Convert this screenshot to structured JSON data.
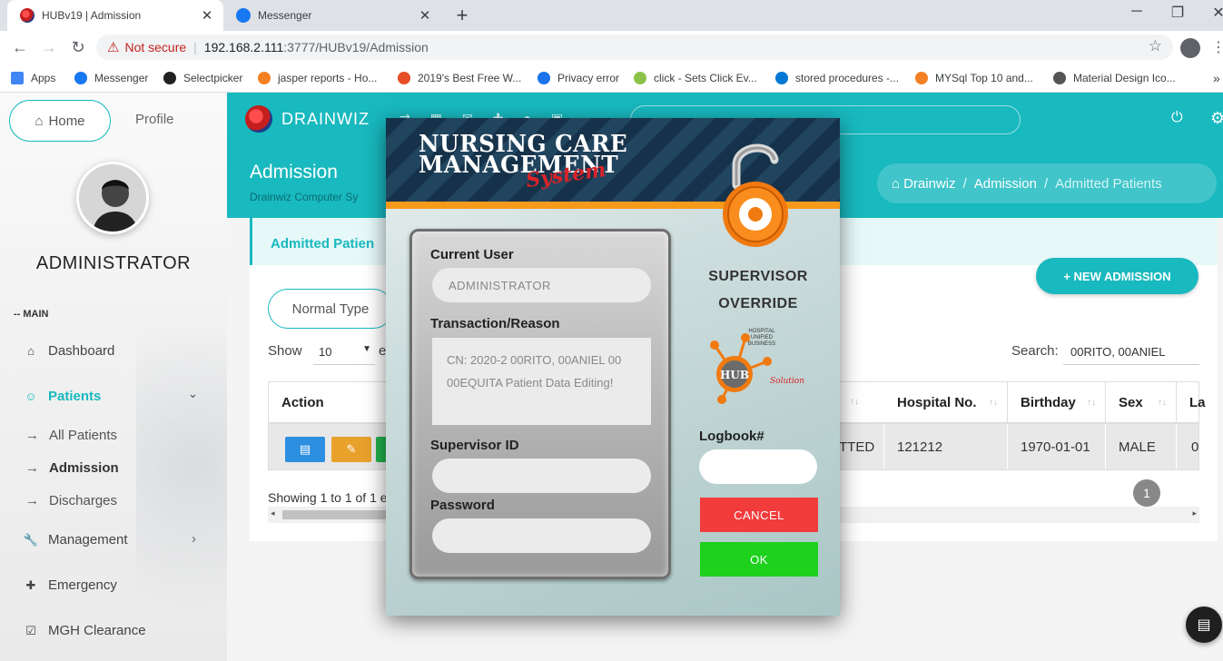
{
  "browser": {
    "tabs": [
      {
        "title": "HUBv19 | Admission",
        "close": "✕"
      },
      {
        "title": "Messenger",
        "close": "✕"
      }
    ],
    "new_tab": "+",
    "window_controls": {
      "minimize": "─",
      "maximize": "❐",
      "close": "✕"
    },
    "nav": {
      "back": "←",
      "forward": "→",
      "reload": "↻"
    },
    "address": {
      "warning_icon": "⚠",
      "not_secure": "Not secure",
      "separator": "|",
      "host": "192.168.2.111",
      "path": ":3777/HUBv19/Admission",
      "star": "☆"
    },
    "bookmarks": [
      {
        "label": "Apps",
        "color": "#4285f4"
      },
      {
        "label": "Messenger",
        "color": "#1877f2"
      },
      {
        "label": "Selectpicker",
        "color": "#222222"
      },
      {
        "label": "jasper reports - Ho...",
        "color": "#f48024"
      },
      {
        "label": "2019's Best Free W...",
        "color": "#e44d26"
      },
      {
        "label": "Privacy error",
        "color": "#1a73e8"
      },
      {
        "label": "click - Sets Click Ev...",
        "color": "#8bc34a"
      },
      {
        "label": "stored procedures -...",
        "color": "#0078d4"
      },
      {
        "label": "MYSql Top 10 and...",
        "color": "#f48024"
      },
      {
        "label": "Material Design Ico...",
        "color": "#555555"
      }
    ],
    "bookmarks_more": "»"
  },
  "sidebar": {
    "home": "Home",
    "profile": "Profile",
    "user_name": "ADMINISTRATOR",
    "section": "-- MAIN",
    "items": [
      {
        "label": "Dashboard",
        "icon": "⌂"
      },
      {
        "label": "Patients",
        "icon": "☺",
        "chevron": "⌄"
      },
      {
        "label": "Management",
        "icon": "🔧",
        "chevron": "›"
      },
      {
        "label": "Emergency",
        "icon": "✚"
      },
      {
        "label": "MGH Clearance",
        "icon": "☑"
      }
    ],
    "sub_items": [
      {
        "label": "All Patients",
        "arrow": "→"
      },
      {
        "label": "Admission",
        "arrow": "→"
      },
      {
        "label": "Discharges",
        "arrow": "→"
      }
    ]
  },
  "topbar": {
    "brand": "DRAINWIZ",
    "power_icon": "⏻",
    "settings_icon": "⚙"
  },
  "header": {
    "title": "Admission",
    "subtitle": "Drainwiz Computer Sy",
    "breadcrumbs": [
      "Drainwiz",
      "Admission",
      "Admitted Patients"
    ],
    "crumb_sep": "/",
    "home_icon": "⌂"
  },
  "card": {
    "tab_title": "Admitted Patien",
    "new_admission": "+ NEW ADMISSION",
    "normal_type": "Normal Type",
    "show_label": "Show",
    "show_value": "10",
    "show_dd": "▼",
    "show_suffix": "e",
    "search_label": "Search:",
    "search_value": "00RITO, 00ANIEL",
    "columns": [
      {
        "label": "Action"
      },
      {
        "label": "Hospital No."
      },
      {
        "label": "Birthday"
      },
      {
        "label": "Sex"
      },
      {
        "label": "La"
      }
    ],
    "sort_icon": "↑↓",
    "row": {
      "status": "TTED",
      "hospital_no": "121212",
      "birthday": "1970-01-01",
      "sex": "MALE",
      "last": "0"
    },
    "showing": "Showing 1 to 1 of 1 e",
    "page": "1",
    "scroll_left": "◂",
    "scroll_right": "▸"
  },
  "modal": {
    "title_line1": "NURSING CARE",
    "title_line2": "MANAGEMENT",
    "title_script": "System",
    "current_user_label": "Current User",
    "current_user_value": "ADMINISTRATOR",
    "reason_label": "Transaction/Reason",
    "reason_value": "CN: 2020-2 00RITO, 00ANIEL 00 00EQUITA Patient Data Editing!",
    "supervisor_id_label": "Supervisor ID",
    "password_label": "Password",
    "override_line1": "SUPERVISOR",
    "override_line2": "OVERRIDE",
    "hub_text": "HUB",
    "hub_caption1": "HOSPITAL",
    "hub_caption2": "UNIFIED",
    "hub_caption3": "BUSINESS",
    "hub_solution": "Solution",
    "logbook_label": "Logbook#",
    "cancel": "CANCEL",
    "ok": "OK"
  },
  "chat_icon": "▤"
}
